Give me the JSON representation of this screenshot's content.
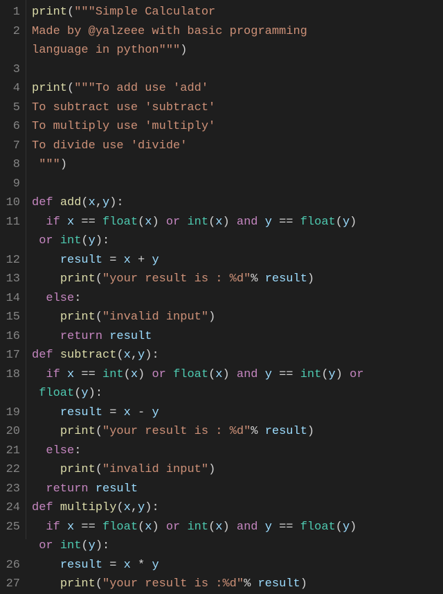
{
  "lines": [
    {
      "n": 1,
      "segs": [
        {
          "c": "fn",
          "t": "print"
        },
        {
          "c": "punct",
          "t": "("
        },
        {
          "c": "str",
          "t": "\"\"\"Simple Calculator"
        }
      ]
    },
    {
      "n": 2,
      "segs": [
        {
          "c": "str",
          "t": "Made by @yalzeee with basic programming "
        }
      ]
    },
    {
      "n": "",
      "segs": [
        {
          "c": "str",
          "t": "language in python\"\"\""
        },
        {
          "c": "punct",
          "t": ")"
        }
      ]
    },
    {
      "n": 3,
      "segs": []
    },
    {
      "n": 4,
      "segs": [
        {
          "c": "fn",
          "t": "print"
        },
        {
          "c": "punct",
          "t": "("
        },
        {
          "c": "str",
          "t": "\"\"\"To add use 'add'"
        }
      ]
    },
    {
      "n": 5,
      "segs": [
        {
          "c": "str",
          "t": "To subtract use 'subtract'"
        }
      ]
    },
    {
      "n": 6,
      "segs": [
        {
          "c": "str",
          "t": "To multiply use 'multiply'"
        }
      ]
    },
    {
      "n": 7,
      "segs": [
        {
          "c": "str",
          "t": "To divide use 'divide'"
        }
      ]
    },
    {
      "n": 8,
      "segs": [
        {
          "c": "str",
          "t": " \"\"\""
        },
        {
          "c": "punct",
          "t": ")"
        }
      ]
    },
    {
      "n": 9,
      "segs": []
    },
    {
      "n": 10,
      "segs": [
        {
          "c": "kw",
          "t": "def"
        },
        {
          "c": "op",
          "t": " "
        },
        {
          "c": "fn",
          "t": "add"
        },
        {
          "c": "punct",
          "t": "("
        },
        {
          "c": "param",
          "t": "x"
        },
        {
          "c": "punct",
          "t": ","
        },
        {
          "c": "param",
          "t": "y"
        },
        {
          "c": "punct",
          "t": "):"
        }
      ]
    },
    {
      "n": 11,
      "segs": [
        {
          "c": "op",
          "t": "  "
        },
        {
          "c": "kw",
          "t": "if"
        },
        {
          "c": "op",
          "t": " "
        },
        {
          "c": "var",
          "t": "x"
        },
        {
          "c": "op",
          "t": " == "
        },
        {
          "c": "builtin",
          "t": "float"
        },
        {
          "c": "punct",
          "t": "("
        },
        {
          "c": "var",
          "t": "x"
        },
        {
          "c": "punct",
          "t": ")"
        },
        {
          "c": "op",
          "t": " "
        },
        {
          "c": "kw",
          "t": "or"
        },
        {
          "c": "op",
          "t": " "
        },
        {
          "c": "builtin",
          "t": "int"
        },
        {
          "c": "punct",
          "t": "("
        },
        {
          "c": "var",
          "t": "x"
        },
        {
          "c": "punct",
          "t": ")"
        },
        {
          "c": "op",
          "t": " "
        },
        {
          "c": "kw",
          "t": "and"
        },
        {
          "c": "op",
          "t": " "
        },
        {
          "c": "var",
          "t": "y"
        },
        {
          "c": "op",
          "t": " == "
        },
        {
          "c": "builtin",
          "t": "float"
        },
        {
          "c": "punct",
          "t": "("
        },
        {
          "c": "var",
          "t": "y"
        },
        {
          "c": "punct",
          "t": ")"
        }
      ]
    },
    {
      "n": "",
      "segs": [
        {
          "c": "op",
          "t": " "
        },
        {
          "c": "kw",
          "t": "or"
        },
        {
          "c": "op",
          "t": " "
        },
        {
          "c": "builtin",
          "t": "int"
        },
        {
          "c": "punct",
          "t": "("
        },
        {
          "c": "var",
          "t": "y"
        },
        {
          "c": "punct",
          "t": "):"
        }
      ]
    },
    {
      "n": 12,
      "segs": [
        {
          "c": "op",
          "t": "    "
        },
        {
          "c": "var",
          "t": "result"
        },
        {
          "c": "op",
          "t": " = "
        },
        {
          "c": "var",
          "t": "x"
        },
        {
          "c": "op",
          "t": " + "
        },
        {
          "c": "var",
          "t": "y"
        }
      ]
    },
    {
      "n": 13,
      "segs": [
        {
          "c": "op",
          "t": "    "
        },
        {
          "c": "fn",
          "t": "print"
        },
        {
          "c": "punct",
          "t": "("
        },
        {
          "c": "str",
          "t": "\"your result is : %d\""
        },
        {
          "c": "op",
          "t": "% "
        },
        {
          "c": "var",
          "t": "result"
        },
        {
          "c": "punct",
          "t": ")"
        }
      ]
    },
    {
      "n": 14,
      "segs": [
        {
          "c": "op",
          "t": "  "
        },
        {
          "c": "kw",
          "t": "else"
        },
        {
          "c": "punct",
          "t": ":"
        }
      ]
    },
    {
      "n": 15,
      "segs": [
        {
          "c": "op",
          "t": "    "
        },
        {
          "c": "fn",
          "t": "print"
        },
        {
          "c": "punct",
          "t": "("
        },
        {
          "c": "str",
          "t": "\"invalid input\""
        },
        {
          "c": "punct",
          "t": ")"
        }
      ]
    },
    {
      "n": 16,
      "segs": [
        {
          "c": "op",
          "t": "    "
        },
        {
          "c": "kw",
          "t": "return"
        },
        {
          "c": "op",
          "t": " "
        },
        {
          "c": "var",
          "t": "result"
        }
      ]
    },
    {
      "n": 17,
      "segs": [
        {
          "c": "kw",
          "t": "def"
        },
        {
          "c": "op",
          "t": " "
        },
        {
          "c": "fn",
          "t": "subtract"
        },
        {
          "c": "punct",
          "t": "("
        },
        {
          "c": "param",
          "t": "x"
        },
        {
          "c": "punct",
          "t": ","
        },
        {
          "c": "param",
          "t": "y"
        },
        {
          "c": "punct",
          "t": "):"
        }
      ]
    },
    {
      "n": 18,
      "segs": [
        {
          "c": "op",
          "t": "  "
        },
        {
          "c": "kw",
          "t": "if"
        },
        {
          "c": "op",
          "t": " "
        },
        {
          "c": "var",
          "t": "x"
        },
        {
          "c": "op",
          "t": " == "
        },
        {
          "c": "builtin",
          "t": "int"
        },
        {
          "c": "punct",
          "t": "("
        },
        {
          "c": "var",
          "t": "x"
        },
        {
          "c": "punct",
          "t": ")"
        },
        {
          "c": "op",
          "t": " "
        },
        {
          "c": "kw",
          "t": "or"
        },
        {
          "c": "op",
          "t": " "
        },
        {
          "c": "builtin",
          "t": "float"
        },
        {
          "c": "punct",
          "t": "("
        },
        {
          "c": "var",
          "t": "x"
        },
        {
          "c": "punct",
          "t": ")"
        },
        {
          "c": "op",
          "t": " "
        },
        {
          "c": "kw",
          "t": "and"
        },
        {
          "c": "op",
          "t": " "
        },
        {
          "c": "var",
          "t": "y"
        },
        {
          "c": "op",
          "t": " == "
        },
        {
          "c": "builtin",
          "t": "int"
        },
        {
          "c": "punct",
          "t": "("
        },
        {
          "c": "var",
          "t": "y"
        },
        {
          "c": "punct",
          "t": ")"
        },
        {
          "c": "op",
          "t": " "
        },
        {
          "c": "kw",
          "t": "or"
        }
      ]
    },
    {
      "n": "",
      "segs": [
        {
          "c": "op",
          "t": " "
        },
        {
          "c": "builtin",
          "t": "float"
        },
        {
          "c": "punct",
          "t": "("
        },
        {
          "c": "var",
          "t": "y"
        },
        {
          "c": "punct",
          "t": "):"
        }
      ]
    },
    {
      "n": 19,
      "segs": [
        {
          "c": "op",
          "t": "    "
        },
        {
          "c": "var",
          "t": "result"
        },
        {
          "c": "op",
          "t": " = "
        },
        {
          "c": "var",
          "t": "x"
        },
        {
          "c": "op",
          "t": " - "
        },
        {
          "c": "var",
          "t": "y"
        }
      ]
    },
    {
      "n": 20,
      "segs": [
        {
          "c": "op",
          "t": "    "
        },
        {
          "c": "fn",
          "t": "print"
        },
        {
          "c": "punct",
          "t": "("
        },
        {
          "c": "str",
          "t": "\"your result is : %d\""
        },
        {
          "c": "op",
          "t": "% "
        },
        {
          "c": "var",
          "t": "result"
        },
        {
          "c": "punct",
          "t": ")"
        }
      ]
    },
    {
      "n": 21,
      "segs": [
        {
          "c": "op",
          "t": "  "
        },
        {
          "c": "kw",
          "t": "else"
        },
        {
          "c": "punct",
          "t": ":"
        }
      ]
    },
    {
      "n": 22,
      "segs": [
        {
          "c": "op",
          "t": "    "
        },
        {
          "c": "fn",
          "t": "print"
        },
        {
          "c": "punct",
          "t": "("
        },
        {
          "c": "str",
          "t": "\"invalid input\""
        },
        {
          "c": "punct",
          "t": ")"
        }
      ]
    },
    {
      "n": 23,
      "segs": [
        {
          "c": "op",
          "t": "  "
        },
        {
          "c": "kw",
          "t": "return"
        },
        {
          "c": "op",
          "t": " "
        },
        {
          "c": "var",
          "t": "result"
        }
      ]
    },
    {
      "n": 24,
      "segs": [
        {
          "c": "kw",
          "t": "def"
        },
        {
          "c": "op",
          "t": " "
        },
        {
          "c": "fn",
          "t": "multiply"
        },
        {
          "c": "punct",
          "t": "("
        },
        {
          "c": "param",
          "t": "x"
        },
        {
          "c": "punct",
          "t": ","
        },
        {
          "c": "param",
          "t": "y"
        },
        {
          "c": "punct",
          "t": "):"
        }
      ]
    },
    {
      "n": 25,
      "segs": [
        {
          "c": "op",
          "t": "  "
        },
        {
          "c": "kw",
          "t": "if"
        },
        {
          "c": "op",
          "t": " "
        },
        {
          "c": "var",
          "t": "x"
        },
        {
          "c": "op",
          "t": " == "
        },
        {
          "c": "builtin",
          "t": "float"
        },
        {
          "c": "punct",
          "t": "("
        },
        {
          "c": "var",
          "t": "x"
        },
        {
          "c": "punct",
          "t": ")"
        },
        {
          "c": "op",
          "t": " "
        },
        {
          "c": "kw",
          "t": "or"
        },
        {
          "c": "op",
          "t": " "
        },
        {
          "c": "builtin",
          "t": "int"
        },
        {
          "c": "punct",
          "t": "("
        },
        {
          "c": "var",
          "t": "x"
        },
        {
          "c": "punct",
          "t": ")"
        },
        {
          "c": "op",
          "t": " "
        },
        {
          "c": "kw",
          "t": "and"
        },
        {
          "c": "op",
          "t": " "
        },
        {
          "c": "var",
          "t": "y"
        },
        {
          "c": "op",
          "t": " == "
        },
        {
          "c": "builtin",
          "t": "float"
        },
        {
          "c": "punct",
          "t": "("
        },
        {
          "c": "var",
          "t": "y"
        },
        {
          "c": "punct",
          "t": ")"
        }
      ]
    },
    {
      "n": "",
      "segs": [
        {
          "c": "op",
          "t": " "
        },
        {
          "c": "kw",
          "t": "or"
        },
        {
          "c": "op",
          "t": " "
        },
        {
          "c": "builtin",
          "t": "int"
        },
        {
          "c": "punct",
          "t": "("
        },
        {
          "c": "var",
          "t": "y"
        },
        {
          "c": "punct",
          "t": "):"
        }
      ]
    },
    {
      "n": 26,
      "segs": [
        {
          "c": "op",
          "t": "    "
        },
        {
          "c": "var",
          "t": "result"
        },
        {
          "c": "op",
          "t": " = "
        },
        {
          "c": "var",
          "t": "x"
        },
        {
          "c": "op",
          "t": " * "
        },
        {
          "c": "var",
          "t": "y"
        }
      ]
    },
    {
      "n": 27,
      "segs": [
        {
          "c": "op",
          "t": "    "
        },
        {
          "c": "fn",
          "t": "print"
        },
        {
          "c": "punct",
          "t": "("
        },
        {
          "c": "str",
          "t": "\"your result is :%d\""
        },
        {
          "c": "op",
          "t": "% "
        },
        {
          "c": "var",
          "t": "result"
        },
        {
          "c": "punct",
          "t": ")"
        }
      ]
    }
  ]
}
